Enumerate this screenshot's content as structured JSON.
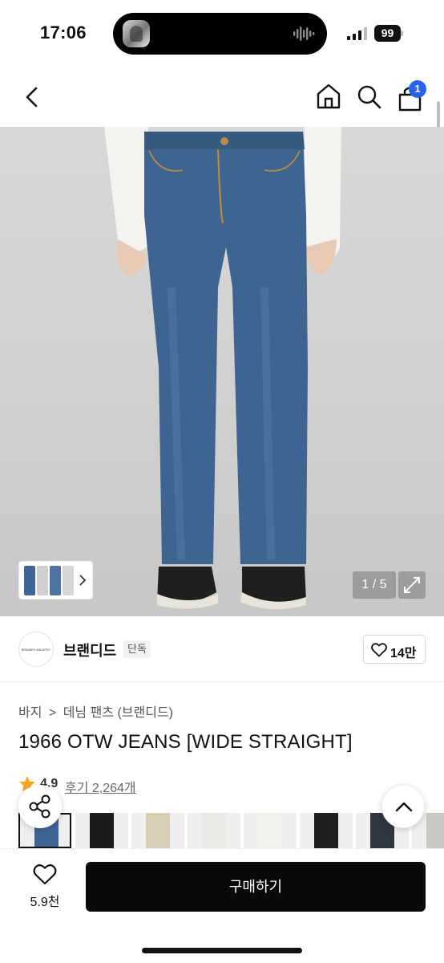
{
  "status_bar": {
    "time": "17:06",
    "battery": "99",
    "icons": [
      "music-cover-icon",
      "waveform-icon",
      "signal-icon",
      "battery-icon"
    ]
  },
  "nav": {
    "icons": [
      "back-icon",
      "home-icon",
      "search-icon",
      "cart-icon"
    ],
    "cart_badge": "1"
  },
  "gallery": {
    "counter": "1 / 5",
    "icons": [
      "expand-icon",
      "chevron-right-icon"
    ]
  },
  "brand": {
    "logo_text": "BRANDED INDUSTRY",
    "name": "브랜디드",
    "tag": "단독",
    "likes": "14만"
  },
  "product": {
    "breadcrumb": [
      "바지",
      ">",
      "데님 팬츠 (브랜디드)"
    ],
    "title": "1966 OTW JEANS [WIDE STRAIGHT]",
    "rating": "4.9",
    "reviews_label": "후기 2,264개"
  },
  "colors": {
    "accent_star": "#f5a623",
    "cart_badge": "#2463eb",
    "buy_button": "#0a0a0a",
    "variants": [
      "#3f6596",
      "#1c1c1c",
      "#d9cdb6",
      "#e9e9e6",
      "#f1f0ea",
      "#202020",
      "#2e3640",
      "#c9c9c4"
    ]
  },
  "bottom_bar": {
    "wish_count": "5.9천",
    "buy_label": "구매하기"
  }
}
